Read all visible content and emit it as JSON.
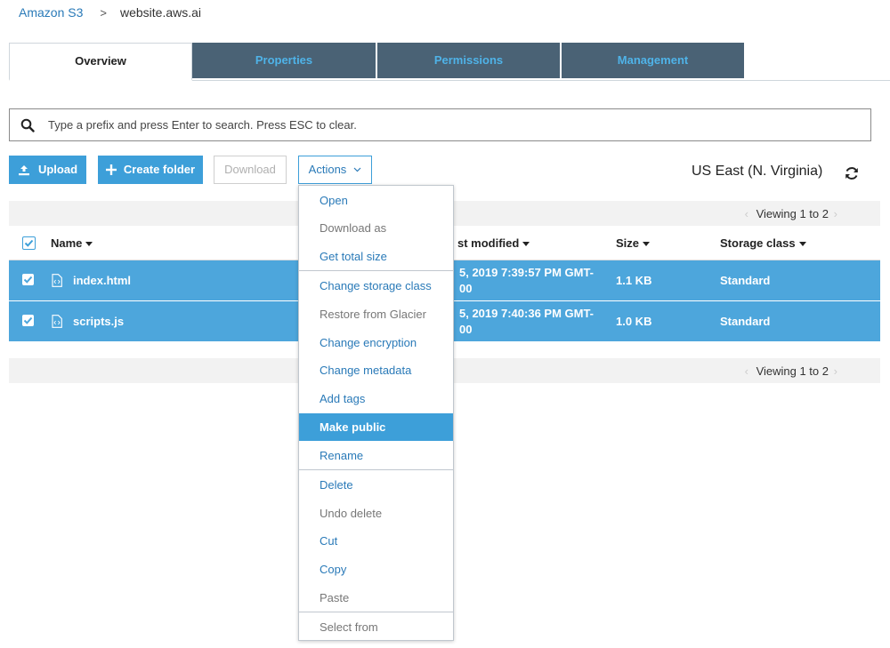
{
  "breadcrumb": {
    "root": "Amazon S3",
    "separator": ">",
    "current": "website.aws.ai"
  },
  "tabs": [
    {
      "label": "Overview",
      "active": true
    },
    {
      "label": "Properties",
      "active": false
    },
    {
      "label": "Permissions",
      "active": false
    },
    {
      "label": "Management",
      "active": false
    }
  ],
  "search": {
    "placeholder": "Type a prefix and press Enter to search. Press ESC to clear.",
    "value": ""
  },
  "toolbar": {
    "upload": "Upload",
    "create_folder": "Create folder",
    "download": "Download",
    "actions": "Actions"
  },
  "region": "US East (N. Virginia)",
  "pagination": {
    "top": "Viewing 1 to 2",
    "bottom": "Viewing 1 to 2"
  },
  "table": {
    "headers": {
      "name": "Name",
      "last_modified": "st modified",
      "size": "Size",
      "storage_class": "Storage class"
    },
    "rows": [
      {
        "name": "index.html",
        "modified_1": "5, 2019 7:39:57 PM GMT-",
        "modified_2": "00",
        "size": "1.1 KB",
        "storage_class": "Standard",
        "checked": true
      },
      {
        "name": "scripts.js",
        "modified_1": "5, 2019 7:40:36 PM GMT-",
        "modified_2": "00",
        "size": "1.0 KB",
        "storage_class": "Standard",
        "checked": true
      }
    ]
  },
  "actions_menu": {
    "open": "Open",
    "download_as": "Download as",
    "get_total_size": "Get total size",
    "change_storage_class": "Change storage class",
    "restore_from_glacier": "Restore from Glacier",
    "change_encryption": "Change encryption",
    "change_metadata": "Change metadata",
    "add_tags": "Add tags",
    "make_public": "Make public",
    "rename": "Rename",
    "delete": "Delete",
    "undo_delete": "Undo delete",
    "cut": "Cut",
    "copy": "Copy",
    "paste": "Paste",
    "select_from": "Select from"
  },
  "icons": {
    "search": "search-icon",
    "upload": "upload-icon",
    "plus": "plus-icon",
    "chevron": "chevron-down-icon",
    "refresh": "refresh-icon",
    "file": "code-file-icon"
  },
  "colors": {
    "accent": "#3d9fd9",
    "selected_row": "#4da6dc",
    "tab_dark": "#4a6275",
    "tab_text": "#4fb3e8",
    "link": "#2a7ab8"
  }
}
